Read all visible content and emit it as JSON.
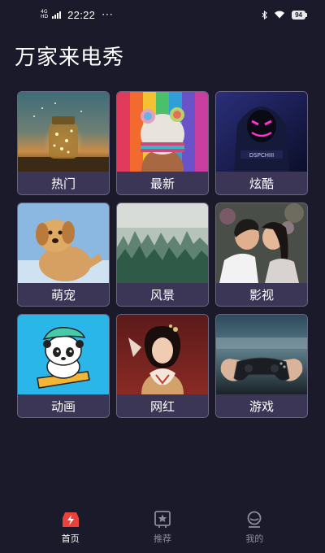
{
  "status_bar": {
    "net_top": "4G",
    "net_bottom": "HD",
    "time": "22:22",
    "more": "···",
    "battery": "94"
  },
  "app_title": "万家来电秀",
  "categories": [
    {
      "label": "热门",
      "image": "glowing-jar-photo"
    },
    {
      "label": "最新",
      "image": "knit-hat-girl-photo"
    },
    {
      "label": "炫酷",
      "image": "neon-mask-hoodie-photo"
    },
    {
      "label": "萌宠",
      "image": "puppy-photo"
    },
    {
      "label": "风景",
      "image": "misty-forest-photo"
    },
    {
      "label": "影视",
      "image": "kissing-couple-photo"
    },
    {
      "label": "动画",
      "image": "cartoon-panda-illustration"
    },
    {
      "label": "网红",
      "image": "costume-girl-with-fox-photo"
    },
    {
      "label": "游戏",
      "image": "gamepad-photo"
    }
  ],
  "bottom_nav": [
    {
      "label": "首页",
      "icon": "home-icon",
      "active": true
    },
    {
      "label": "推荐",
      "icon": "star-frame-icon",
      "active": false
    },
    {
      "label": "我的",
      "icon": "profile-icon",
      "active": false
    }
  ],
  "colors": {
    "background": "#1b1a2a",
    "card_label_bg": "#3c3656",
    "card_border": "#6a6580",
    "active_accent": "#e8423a",
    "inactive_nav": "#8d8a9c"
  }
}
